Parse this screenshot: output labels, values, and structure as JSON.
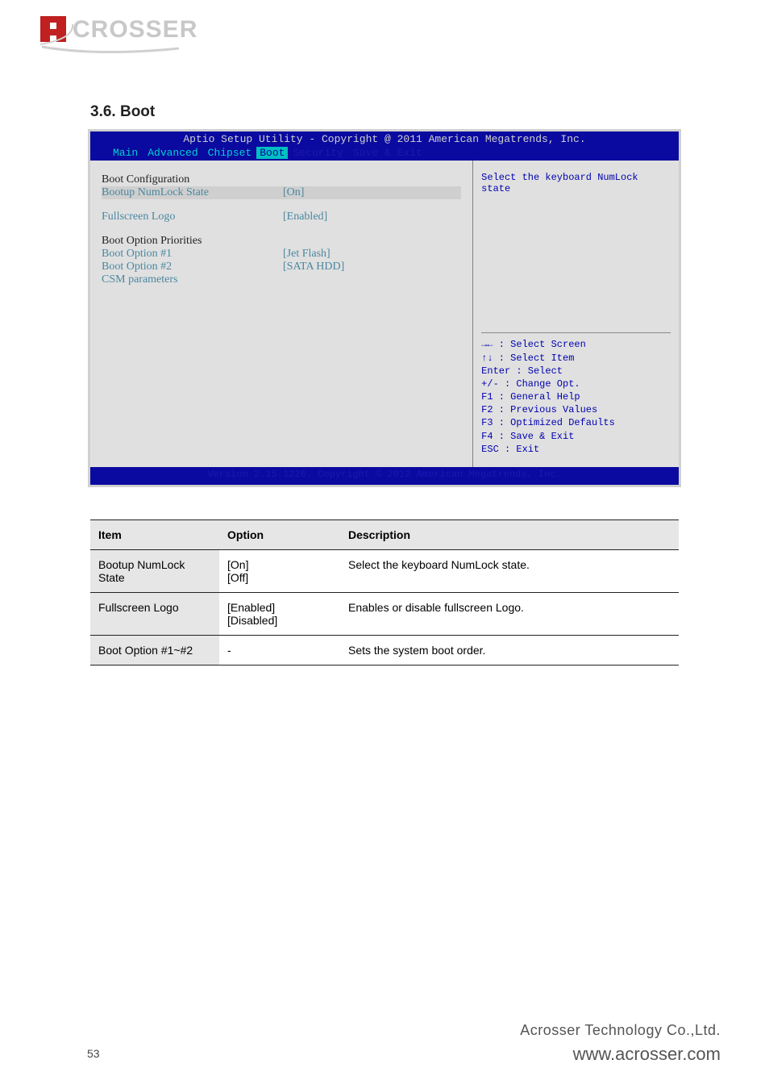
{
  "logo_alt": "ACROSSER",
  "section": {
    "number": "3.6.",
    "title": "Boot"
  },
  "bios": {
    "title": "Aptio Setup Utility - Copyright @ 2011 American Megatrends, Inc.",
    "tabs": {
      "main": "Main",
      "advanced": "Advanced",
      "chipset": "Chipset",
      "boot": "Boot",
      "security": "Security",
      "save": "Save & Exit"
    },
    "left": {
      "boot_config_header": "Boot Configuration",
      "numlock_label": "Bootup NumLock State",
      "numlock_value": "[On]",
      "fullscreen_label": "Fullscreen Logo",
      "fullscreen_value": "[Enabled]",
      "priorities_header": "Boot Option Priorities",
      "opt1_label": "Boot Option #1",
      "opt1_value": "[Jet Flash]",
      "opt2_label": "Boot Option #2",
      "opt2_value": "[SATA HDD]",
      "csm_label": "CSM parameters"
    },
    "right": {
      "help_text": "Select the keyboard NumLock state",
      "keys": {
        "k1": "→← : Select Screen",
        "k2": "↑↓ : Select Item",
        "k3": "Enter : Select",
        "k4": "+/- : Change Opt.",
        "k5": "F1 : General Help",
        "k6": "F2 : Previous Values",
        "k7": "F3 : Optimized Defaults",
        "k8": "F4 : Save & Exit",
        "k9": "ESC : Exit"
      }
    },
    "footer": "Version 2.15.1226. Copyright © 2012 American Megatrends, Inc."
  },
  "table": {
    "headers": {
      "h1": "Item",
      "h2": "Option",
      "h3": "Description"
    },
    "rows": [
      {
        "item": "Bootup NumLock State",
        "option": "[On]\n[Off]",
        "desc": "Select the keyboard NumLock state."
      },
      {
        "item": "Fullscreen Logo",
        "option": "[Enabled]\n[Disabled]",
        "desc": "Enables or disable fullscreen Logo."
      },
      {
        "item": "Boot Option #1~#2",
        "option": "-",
        "desc": "Sets the system boot order."
      }
    ]
  },
  "footer": {
    "company": "Acrosser Technology Co.,Ltd.",
    "url": "www.acrosser.com",
    "page_number": "53"
  }
}
